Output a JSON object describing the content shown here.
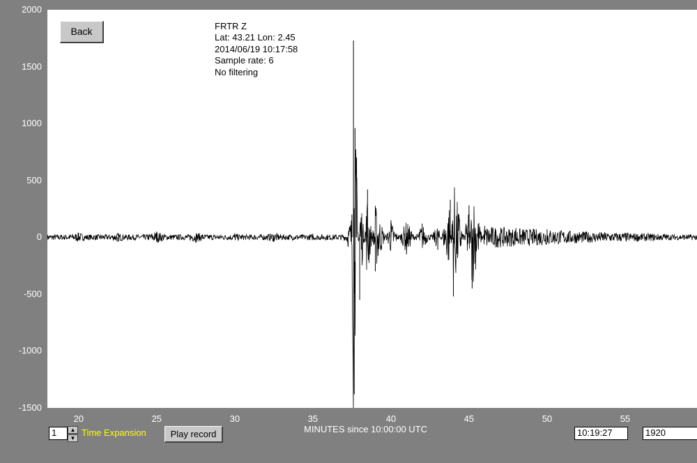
{
  "buttons": {
    "back": "Back",
    "play": "Play record"
  },
  "info": {
    "station": "FRTR  Z",
    "location": "Lat: 43.21 Lon: 2.45",
    "datetime": "2014/06/19 10:17:58",
    "sample_rate": "Sample rate: 6",
    "filter": "No filtering"
  },
  "controls": {
    "time_expansion_value": "1",
    "time_expansion_label": "Time Expansion",
    "cursor_time": "10:19:27",
    "samples_field": "1920",
    "xaxis_title": "MINUTES since 10:00:00 UTC"
  },
  "colors": {
    "background": "#808080",
    "plot": "#ffffff",
    "trace": "#000000",
    "label": "#ffffff",
    "accent": "#ffff00"
  },
  "chart_data": {
    "type": "line",
    "title": "",
    "xlabel": "MINUTES since 10:00:00 UTC",
    "ylabel": "",
    "xlim": [
      18.0,
      59.6
    ],
    "ylim": [
      -1500,
      2000
    ],
    "xticks": [
      "20",
      "25",
      "30",
      "35",
      "40",
      "45",
      "50",
      "55"
    ],
    "yticks": [
      "2000",
      "1500",
      "1000",
      "500",
      "0",
      "-500",
      "-1000",
      "-1500"
    ],
    "series": [
      {
        "x": [
          18.0,
          20.0,
          22.5,
          25.0,
          27.5,
          30.0,
          32.5,
          35.0,
          37.0,
          37.5,
          37.6,
          37.65,
          37.7,
          37.8,
          38.0,
          38.5,
          39.0,
          40.0,
          41.0,
          42.0,
          43.0,
          43.8,
          44.0,
          45.0,
          45.2,
          46.0,
          48.0,
          50.0,
          52.5,
          55.0,
          57.5,
          59.6
        ],
        "y": [
          0,
          40,
          -40,
          50,
          -45,
          35,
          -40,
          30,
          -30,
          200,
          1730,
          -1380,
          960,
          700,
          -550,
          420,
          -300,
          150,
          -150,
          120,
          -110,
          330,
          -520,
          280,
          -450,
          100,
          80,
          70,
          50,
          40,
          30,
          0
        ]
      }
    ]
  }
}
